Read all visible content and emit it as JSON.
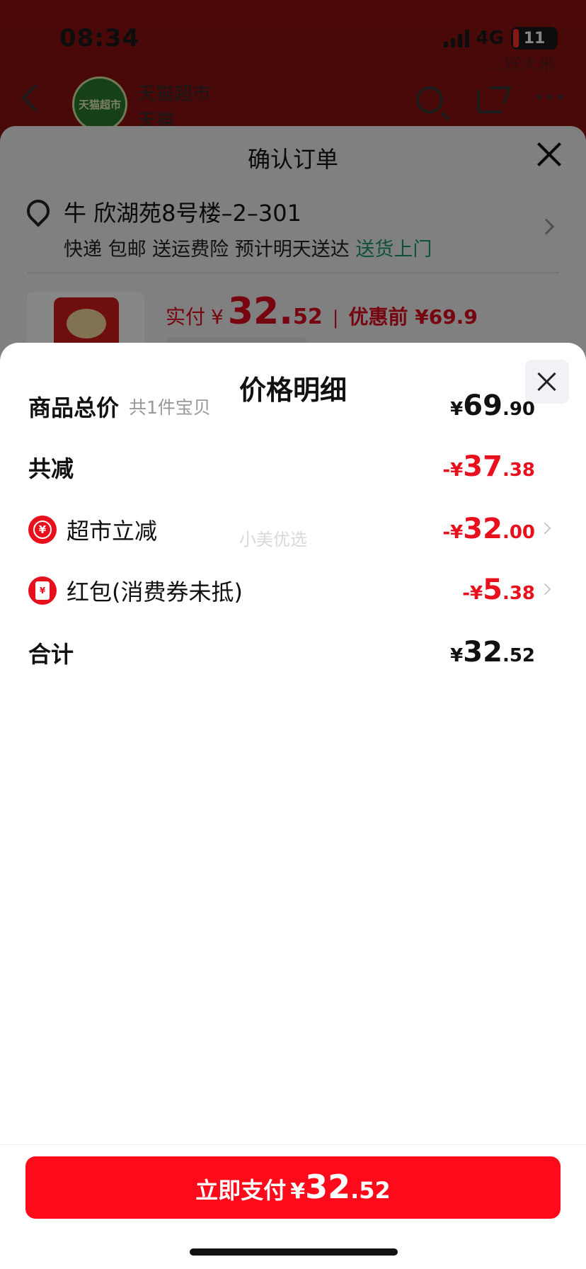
{
  "status_bar": {
    "time": "08:34",
    "network": "4G",
    "battery": "11"
  },
  "background": {
    "brand_ghost": "...好大米",
    "shop": {
      "logo_text": "天猫超市",
      "name": "天猫超市",
      "sub": "天猫"
    },
    "confirm_order": {
      "title": "确认订单",
      "address": "牛 欣湖苑8号楼–2–301",
      "delivery_text": "快递 包邮 送运费险 预计明天送达",
      "delivery_highlight": "送货上门",
      "pay": {
        "label": "实付",
        "currency": "¥",
        "integer": "32.",
        "decimal": "52",
        "separator": "|",
        "original": "优惠前 ¥69.9"
      }
    }
  },
  "price_detail": {
    "title": "价格明细",
    "watermark": "小美优选",
    "rows": {
      "subtotal": {
        "label": "商品总价",
        "hint": "共1件宝贝",
        "cur": "¥",
        "int": "69",
        "dec": ".90"
      },
      "discount_total": {
        "label": "共减",
        "cur": "-¥",
        "int": "37",
        "dec": ".38"
      },
      "supermarket": {
        "label": "超市立减",
        "icon_glyph": "¥",
        "cur": "-¥",
        "int": "32",
        "dec": ".00"
      },
      "redpacket": {
        "label": "红包(消费券未抵)",
        "icon_glyph": "¥",
        "cur": "-¥",
        "int": "5",
        "dec": ".38"
      },
      "total": {
        "label": "合计",
        "cur": "¥",
        "int": "32",
        "dec": ".52"
      }
    }
  },
  "pay_button": {
    "label": "立即支付",
    "cur": "¥",
    "int": "32",
    "dec": ".52"
  },
  "colors": {
    "accent_red": "#e8101c",
    "button_red": "#ff0a1a",
    "green": "#1a9b6a"
  }
}
